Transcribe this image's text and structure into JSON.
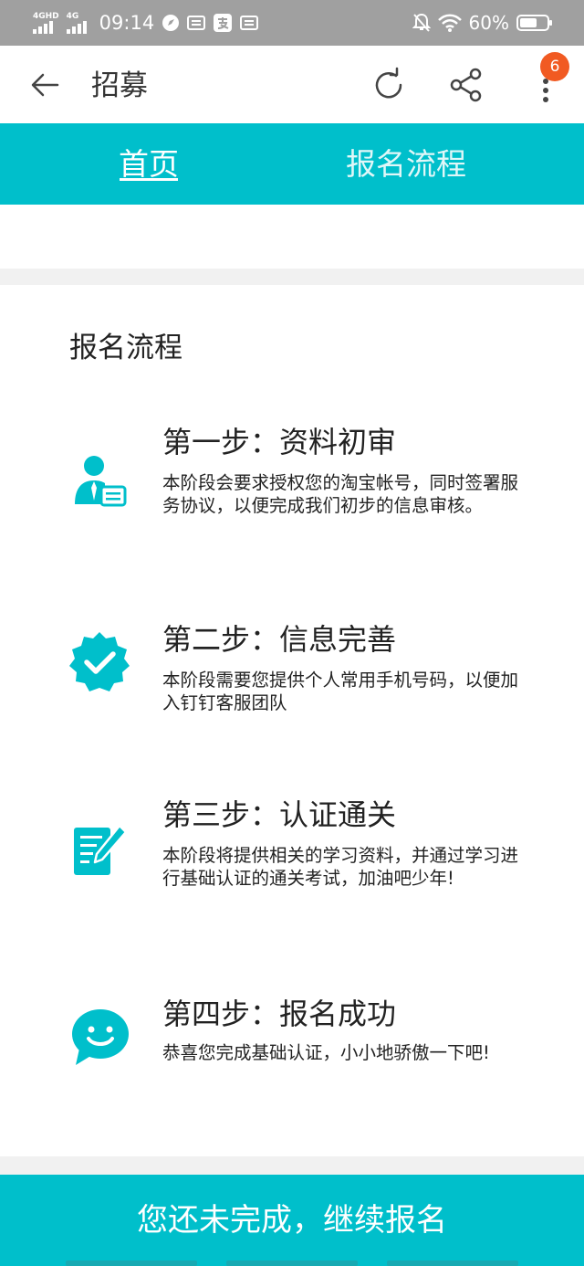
{
  "status_bar": {
    "network_1": "4GHD",
    "network_2": "4G",
    "time": "09:14",
    "battery_text": "60%"
  },
  "app_bar": {
    "title": "招募",
    "menu_badge": "6"
  },
  "tabs": [
    {
      "label": "首页",
      "active": true
    },
    {
      "label": "报名流程",
      "active": false
    }
  ],
  "section": {
    "title": "报名流程"
  },
  "steps": [
    {
      "title": "第一步：资料初审",
      "desc": "本阶段会要求授权您的淘宝帐号，同时签署服务协议，以便完成我们初步的信息审核。",
      "icon": "user-card-icon"
    },
    {
      "title": "第二步：信息完善",
      "desc": "本阶段需要您提供个人常用手机号码，以便加入钉钉客服团队",
      "icon": "verified-badge-icon"
    },
    {
      "title": "第三步：认证通关",
      "desc": "本阶段将提供相关的学习资料，并通过学习进行基础认证的通关考试，加油吧少年!",
      "icon": "edit-document-icon"
    },
    {
      "title": "第四步：报名成功",
      "desc": "恭喜您完成基础认证，小小地骄傲一下吧!",
      "icon": "smile-chat-icon"
    }
  ],
  "cta": {
    "label": "您还未完成，继续报名"
  },
  "colors": {
    "accent": "#00bfcb",
    "badge": "#f15a22",
    "status_bar": "#a0a0a0"
  }
}
